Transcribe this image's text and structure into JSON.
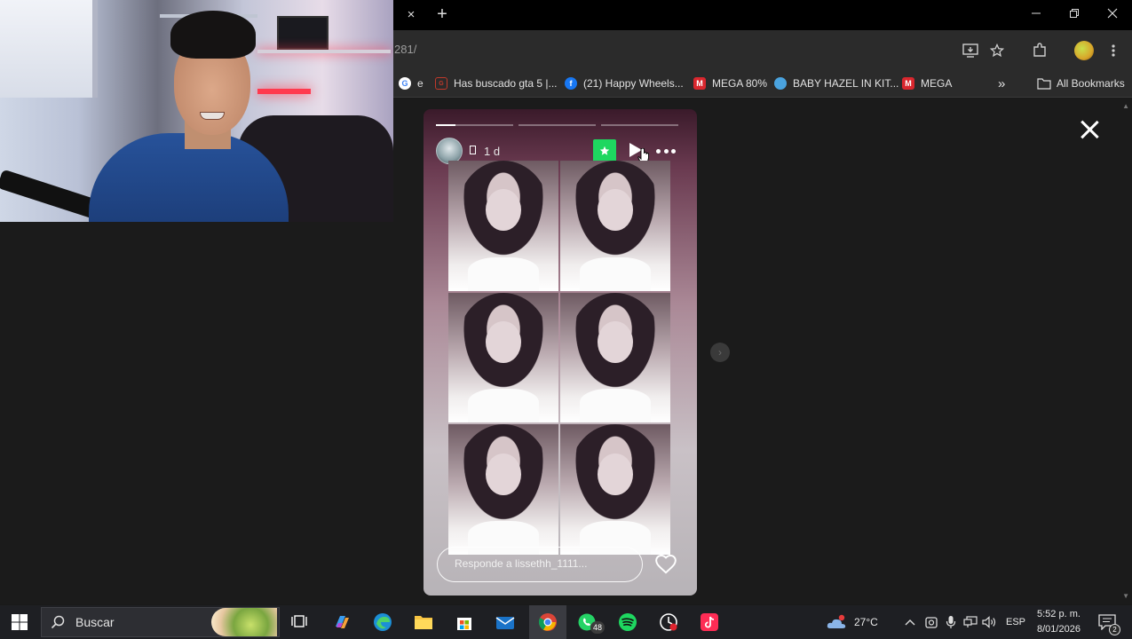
{
  "browser": {
    "tab_close_glyph": "×",
    "new_tab_glyph": "+",
    "url_fragment": "281/",
    "bookmarks": [
      {
        "label": "e",
        "icon": "google-icon",
        "color": "#4285f4"
      },
      {
        "label": "Has buscado gta 5 |...",
        "icon": "site-icon",
        "color": "#c0392b"
      },
      {
        "label": "(21) Happy Wheels...",
        "icon": "facebook-icon",
        "color": "#1877f2"
      },
      {
        "label": "MEGA 80%",
        "icon": "mega-icon",
        "color": "#d9272e"
      },
      {
        "label": "BABY HAZEL IN KIT...",
        "icon": "site-icon",
        "color": "#4aa3df"
      },
      {
        "label": "MEGA",
        "icon": "mega-icon",
        "color": "#d9272e"
      }
    ],
    "more_bookmarks": "»",
    "all_bookmarks": "All Bookmarks"
  },
  "story": {
    "time_ago": "1 d",
    "reply_placeholder": "Responde a lissethh_1111...",
    "progress_segments": [
      0.25,
      0,
      0
    ],
    "star_color": "#1ed760"
  },
  "taskbar": {
    "search_label": "Buscar",
    "whatsapp_badge": "48",
    "weather": "27°C",
    "language": "ESP",
    "time": "5:52 p. m.",
    "date": "8/01/2026",
    "notification_count": "2"
  }
}
